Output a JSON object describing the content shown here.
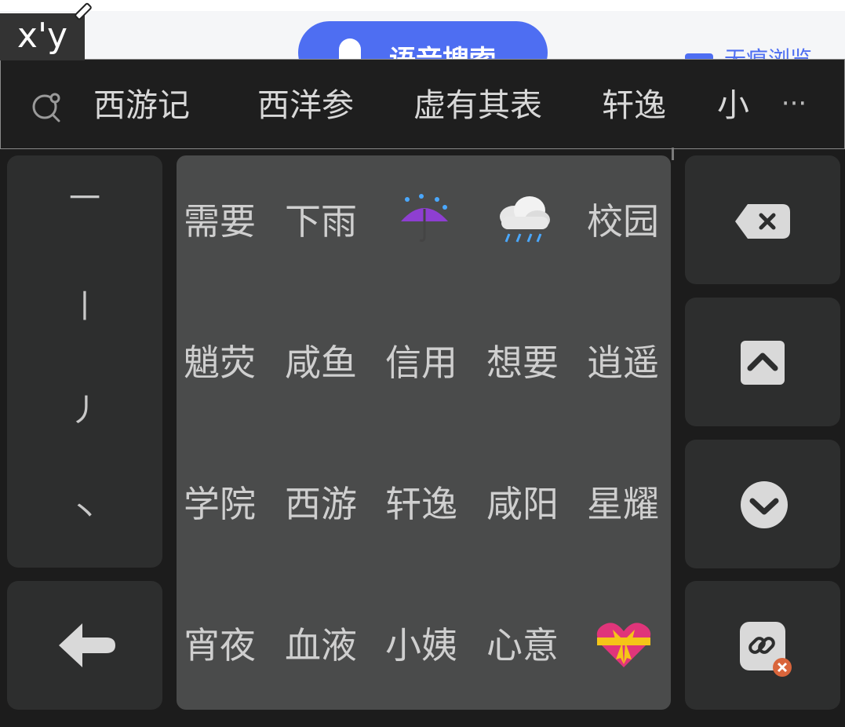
{
  "background_page": {
    "voice_button_label": "语音搜索",
    "incognito_label": "无痕浏览"
  },
  "composition": {
    "text": "x'y"
  },
  "candidate_bar": {
    "items": [
      "西游记",
      "西洋参",
      "虚有其表",
      "轩逸",
      "小"
    ],
    "more_label": "···"
  },
  "stroke_keys": [
    "一",
    "丨",
    "丿",
    "丶"
  ],
  "word_grid": {
    "rows": [
      [
        "需要",
        "下雨",
        "☔",
        "🌧",
        "校园"
      ],
      [
        "魈荧",
        "咸鱼",
        "信用",
        "想要",
        "逍遥"
      ],
      [
        "学院",
        "西游",
        "轩逸",
        "咸阳",
        "星耀"
      ],
      [
        "宵夜",
        "血液",
        "小姨",
        "心意",
        "💝"
      ]
    ]
  },
  "icons": {
    "search": "search-icon",
    "delete": "backspace-icon",
    "page_up": "chevron-up-icon",
    "page_down": "chevron-down-icon",
    "back": "back-arrow-icon",
    "link": "link-icon"
  },
  "colors": {
    "keyboard_bg": "#1c1c1c",
    "key_bg": "#2d2e2e",
    "grid_bg": "#4a4b4b",
    "accent_blue": "#4e6ef2"
  }
}
